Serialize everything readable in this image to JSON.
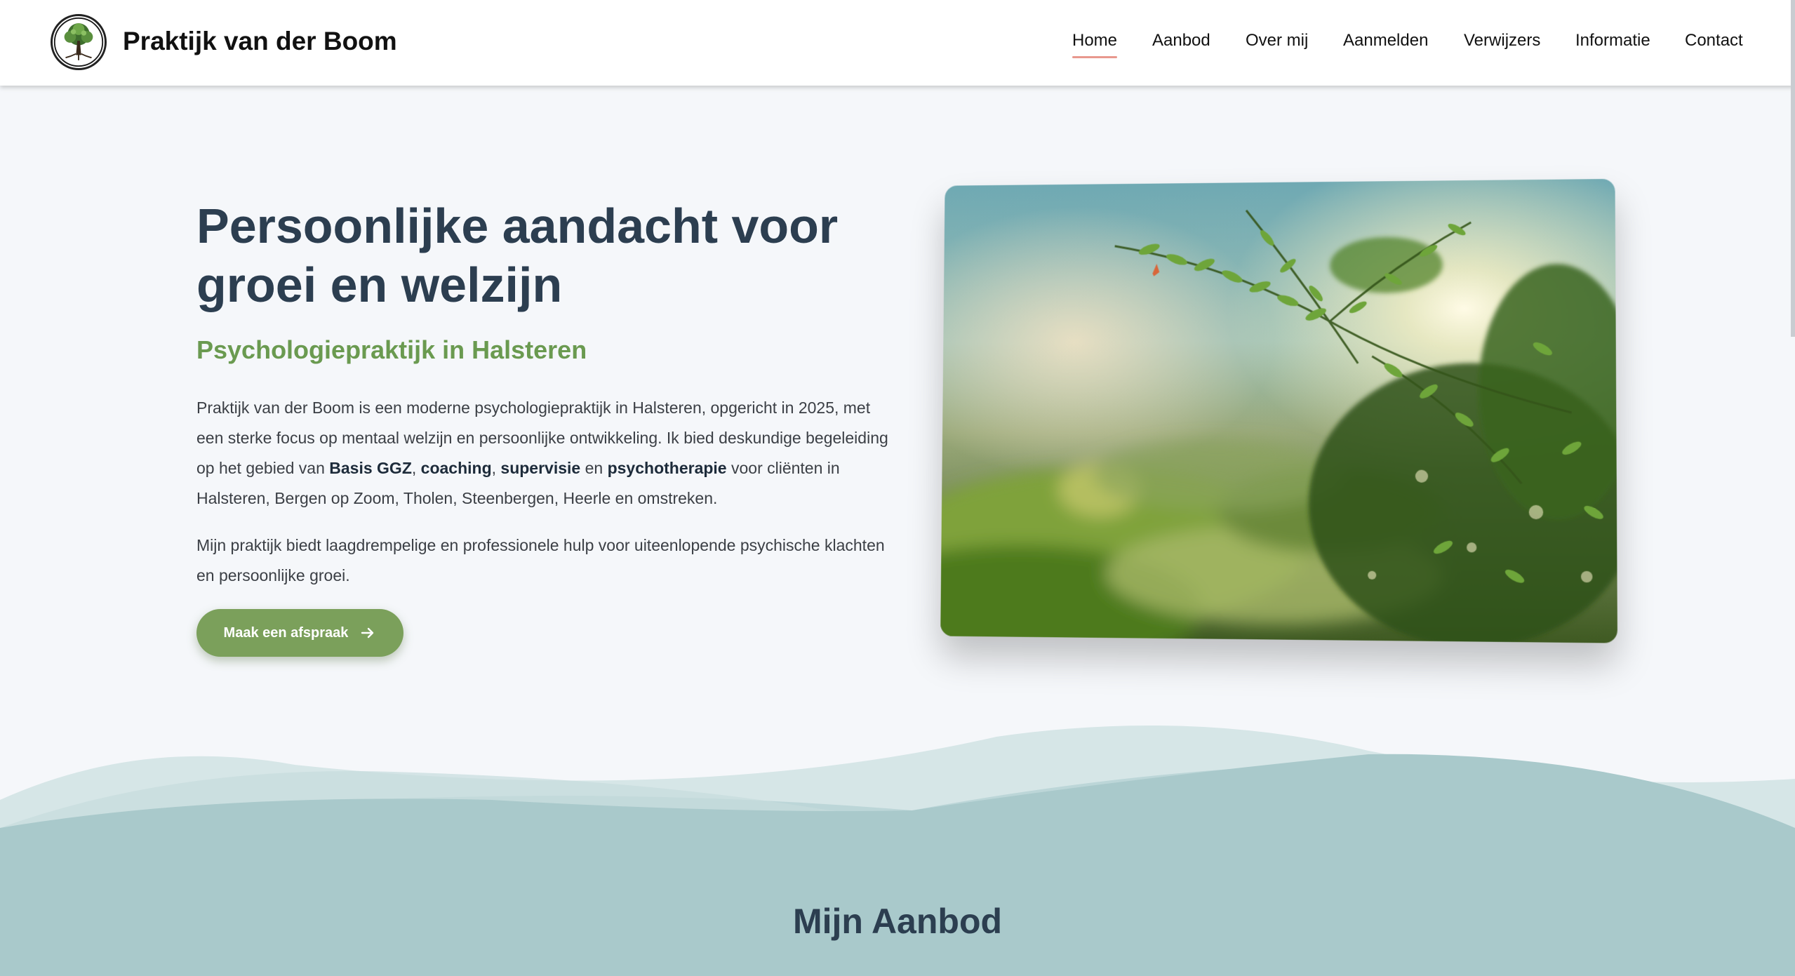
{
  "brand": {
    "name": "Praktijk van der Boom",
    "logo_icon": "tree-logo-icon"
  },
  "nav": {
    "items": [
      {
        "label": "Home",
        "active": true
      },
      {
        "label": "Aanbod",
        "active": false
      },
      {
        "label": "Over mij",
        "active": false
      },
      {
        "label": "Aanmelden",
        "active": false
      },
      {
        "label": "Verwijzers",
        "active": false
      },
      {
        "label": "Informatie",
        "active": false
      },
      {
        "label": "Contact",
        "active": false
      }
    ]
  },
  "hero": {
    "title": "Persoonlijke aandacht voor groei en welzijn",
    "subtitle": "Psychologiepraktijk in Halsteren",
    "paragraph1": {
      "intro": "Praktijk van der Boom is een moderne psychologiepraktijk in Halsteren, opgericht in 2025, met een sterke focus op mentaal welzijn en persoonlijke ontwikkeling. Ik bied deskundige begeleiding op het gebied van ",
      "service1": "Basis GGZ",
      "sep1": ", ",
      "service2": "coaching",
      "sep2": ", ",
      "service3": "supervisie",
      "sep3": " en ",
      "service4": "psychotherapie",
      "outro": " voor cliënten in Halsteren, Bergen op Zoom, Tholen, Steenbergen, Heerle en omstreken."
    },
    "paragraph2": "Mijn praktijk biedt laagdrempelige en professionele hulp voor uiteenlopende psychische klachten en persoonlijke groei.",
    "cta_label": "Maak een afspraak",
    "cta_icon": "arrow-right-icon",
    "image_subject": "nature-leaves-sunlight-image"
  },
  "section": {
    "title": "Mijn Aanbod"
  },
  "colors": {
    "accent_green": "#7ba05b",
    "subtitle_green": "#6a9a50",
    "heading_navy": "#2c3e50",
    "nav_underline": "#e8988e",
    "wave_teal": "#a9c9cb",
    "background": "#f5f7fa"
  }
}
